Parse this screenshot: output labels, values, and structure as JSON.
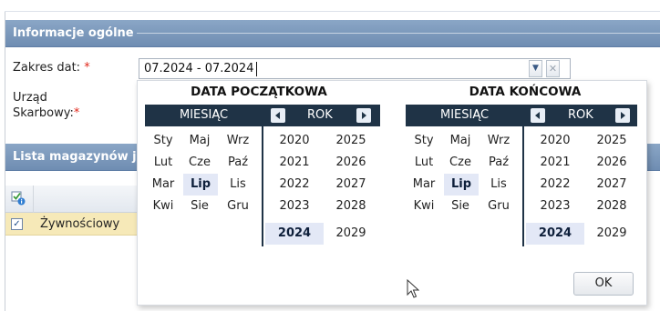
{
  "sections": {
    "general_info": "Informacje ogólne",
    "warehouses_list": "Lista magazynów je"
  },
  "form": {
    "date_range_label": "Zakres dat:",
    "date_range_value": "07.2024 - 07.2024",
    "tax_office_label_line1": "Urząd",
    "tax_office_label_line2": "Skarbowy:",
    "required_mark": "*"
  },
  "grid": {
    "rows": [
      {
        "checked": true,
        "name": "Żywnościowy"
      }
    ]
  },
  "picker": {
    "start": {
      "title": "DATA POCZĄTKOWA",
      "month_header": "MIESIĄC",
      "year_header": "ROK",
      "months": [
        "Sty",
        "Maj",
        "Wrz",
        "Lut",
        "Cze",
        "Paź",
        "Mar",
        "Lip",
        "Lis",
        "Kwi",
        "Sie",
        "Gru"
      ],
      "selected_month": "Lip",
      "years": [
        "2020",
        "2025",
        "2021",
        "2026",
        "2022",
        "2027",
        "2023",
        "2028",
        "2024",
        "2029"
      ],
      "selected_year": "2024"
    },
    "end": {
      "title": "DATA KOŃCOWA",
      "month_header": "MIESIĄC",
      "year_header": "ROK",
      "months": [
        "Sty",
        "Maj",
        "Wrz",
        "Lut",
        "Cze",
        "Paź",
        "Mar",
        "Lip",
        "Lis",
        "Kwi",
        "Sie",
        "Gru"
      ],
      "selected_month": "Lip",
      "years": [
        "2020",
        "2025",
        "2021",
        "2026",
        "2022",
        "2027",
        "2023",
        "2028",
        "2024",
        "2029"
      ],
      "selected_year": "2024"
    },
    "ok_label": "OK"
  },
  "icons": {
    "dropdown": "chevron-down-icon",
    "clear": "close-icon",
    "grid_header": "check-info-icon",
    "prev": "chevron-left-icon",
    "next": "chevron-right-icon",
    "cursor": "mouse-pointer-icon"
  },
  "colors": {
    "section_header": "#7795b9",
    "picker_bar": "#1f3346",
    "selected_cell": "#e3e8f6",
    "selected_row": "#f6e9b8",
    "required": "#e0271a"
  }
}
